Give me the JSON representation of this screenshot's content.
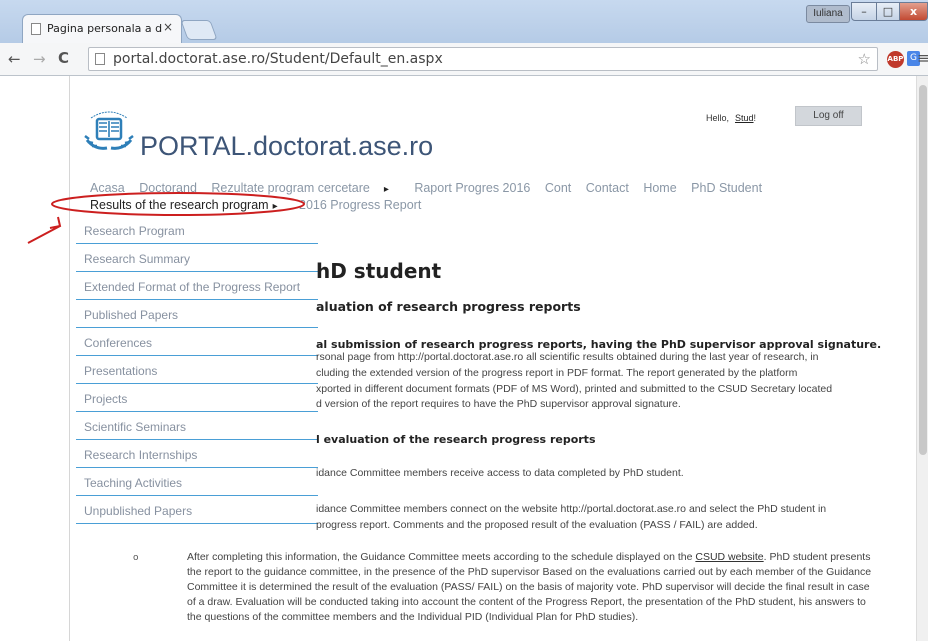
{
  "browser": {
    "tab_title": "Pagina personala a doctor",
    "url": "portal.doctorat.ase.ro/Student/Default_en.aspx",
    "user_button": "Iuliana",
    "abp_label": "ABP",
    "translate_label": "G"
  },
  "header": {
    "site_title": "PORTAL.doctorat.ase.ro",
    "greeting": "Hello,",
    "user_name": "Stud",
    "greeting_end": "!",
    "logoff_label": "Log off"
  },
  "nav": {
    "items": [
      "Acasa",
      "Doctorand",
      "Rezultate program cercetare",
      "Raport Progres 2016",
      "Cont",
      "Contact",
      "Home",
      "PhD Student"
    ],
    "arrow": "▸",
    "dropdown_trigger": "Results of the research program",
    "subitem": "2016 Progress Report"
  },
  "dropdown": {
    "items": [
      "Research Program",
      "Research Summary",
      "Extended Format of the Progress Report",
      "Published Papers",
      "Conferences",
      "Presentations",
      "Projects",
      "Scientific Seminars",
      "Research Internships",
      "Teaching Activities",
      "Unpublished Papers"
    ]
  },
  "content": {
    "heading": "hD student",
    "subheading": "aluation of research progress reports",
    "section1_title": "al submission of research progress reports, having the PhD supervisor approval signature.",
    "section1_lines": [
      "rsonal page from http://portal.doctorat.ase.ro all scientific results obtained during the last year of research, in",
      "cluding the extended version of the progress report in PDF format. The report generated by the platform",
      "xported in different document formats (PDF of MS Word), printed and submitted to the CSUD Secretary located",
      "d version of the report requires to have the PhD supervisor approval signature."
    ],
    "section2_title": "l evaluation of the research progress reports",
    "line_a": "idance Committee members receive access to data completed by PhD student.",
    "line_b1": "idance Committee members connect on the website http://portal.doctorat.ase.ro and select the PhD student in",
    "line_b2": "progress report. Comments and the proposed result of the evaluation (PASS / FAIL) are added.",
    "bullet": "o",
    "para3_start": "After completing this information, the Guidance Committee meets according to the schedule displayed on the",
    "para3_link": "CSUD website",
    "para3_rest": ". PhD student presents the report to the guidance committee, in the presence of the PhD supervisor Based on the evaluations carried out by each member of the Guidance Committee it is determined the result of the evaluation (PASS/ FAIL) on the basis of majority vote. PhD supervisor will decide the final result in case of a draw. Evaluation will be conducted taking into account the content of the Progress Report, the presentation of the PhD student, his answers to the questions of the committee members and the Individual PID (Individual Plan for PhD studies)."
  },
  "colors": {
    "annotation": "#cc1f1f",
    "dropdown_divider": "#4a9fd6",
    "title": "#3d5577"
  }
}
